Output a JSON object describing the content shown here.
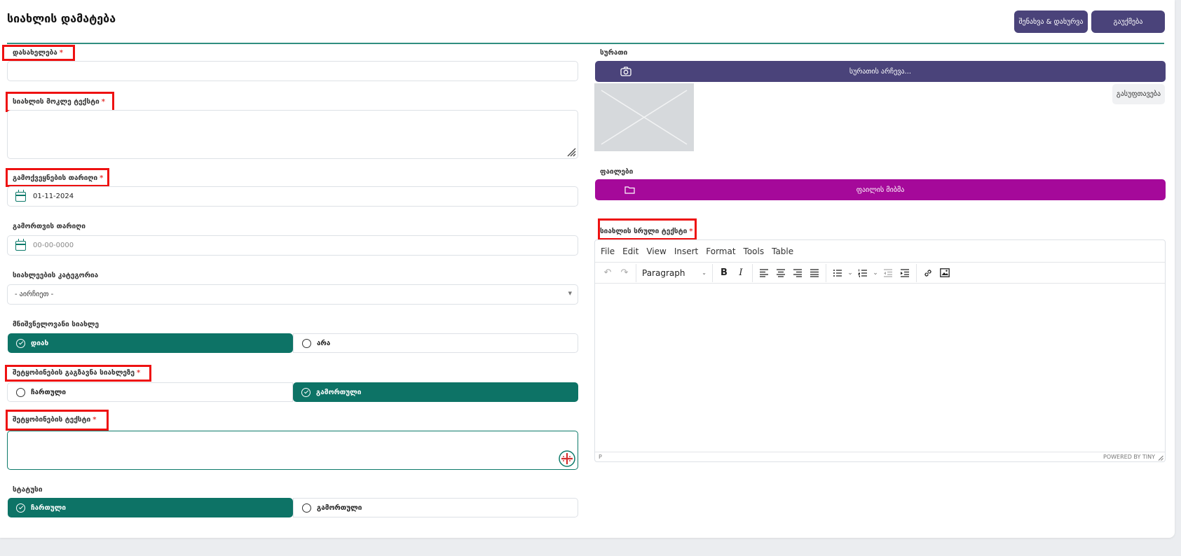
{
  "header": {
    "title": "სიახლის დამატება",
    "save_close_label": "შენახვა & დახურვა",
    "cancel_label": "გაუქმება"
  },
  "left": {
    "title_label": "დასახელება",
    "title_value": "",
    "short_text_label": "სიახლის მოკლე ტექსტი",
    "publish_date_label": "გამოქვეყნების თარიღი",
    "publish_date_value": "01-11-2024",
    "off_date_label": "გამორთვის თარიღი",
    "off_date_placeholder": "00-00-0000",
    "category_label": "სიახლეების კატეგორია",
    "category_selected": "- აირჩიეთ -",
    "important_label": "მნიშვნელოვანი სიახლე",
    "important_options": [
      "დიახ",
      "არა"
    ],
    "important_selected": 0,
    "notify_label": "შეტყობინების გაგზავნა სიახლეზე",
    "notify_options": [
      "ჩართული",
      "გამორთული"
    ],
    "notify_selected": 1,
    "notify_text_label": "შეტყობინების ტექსტი",
    "status_label": "სტატუსი",
    "status_options": [
      "ჩართული",
      "გამორთული"
    ],
    "status_selected": 0,
    "required_mark": "*"
  },
  "right": {
    "image_label": "სურათი",
    "choose_image_label": "სურათის არჩევა...",
    "clear_label": "გასუფთავება",
    "files_label": "ფაილები",
    "attach_file_label": "ფაილის მიბმა",
    "full_text_label": "სიახლის სრული ტექსტი"
  },
  "editor": {
    "menus": [
      "File",
      "Edit",
      "View",
      "Insert",
      "Format",
      "Tools",
      "Table"
    ],
    "format_selected": "Paragraph",
    "path": "P",
    "branding": "POWERED BY TINY"
  },
  "colors": {
    "primary": "#4a437a",
    "accent": "#0d7366",
    "file_button": "#a5099a",
    "required": "#e53935",
    "highlight": "#ee1111"
  }
}
